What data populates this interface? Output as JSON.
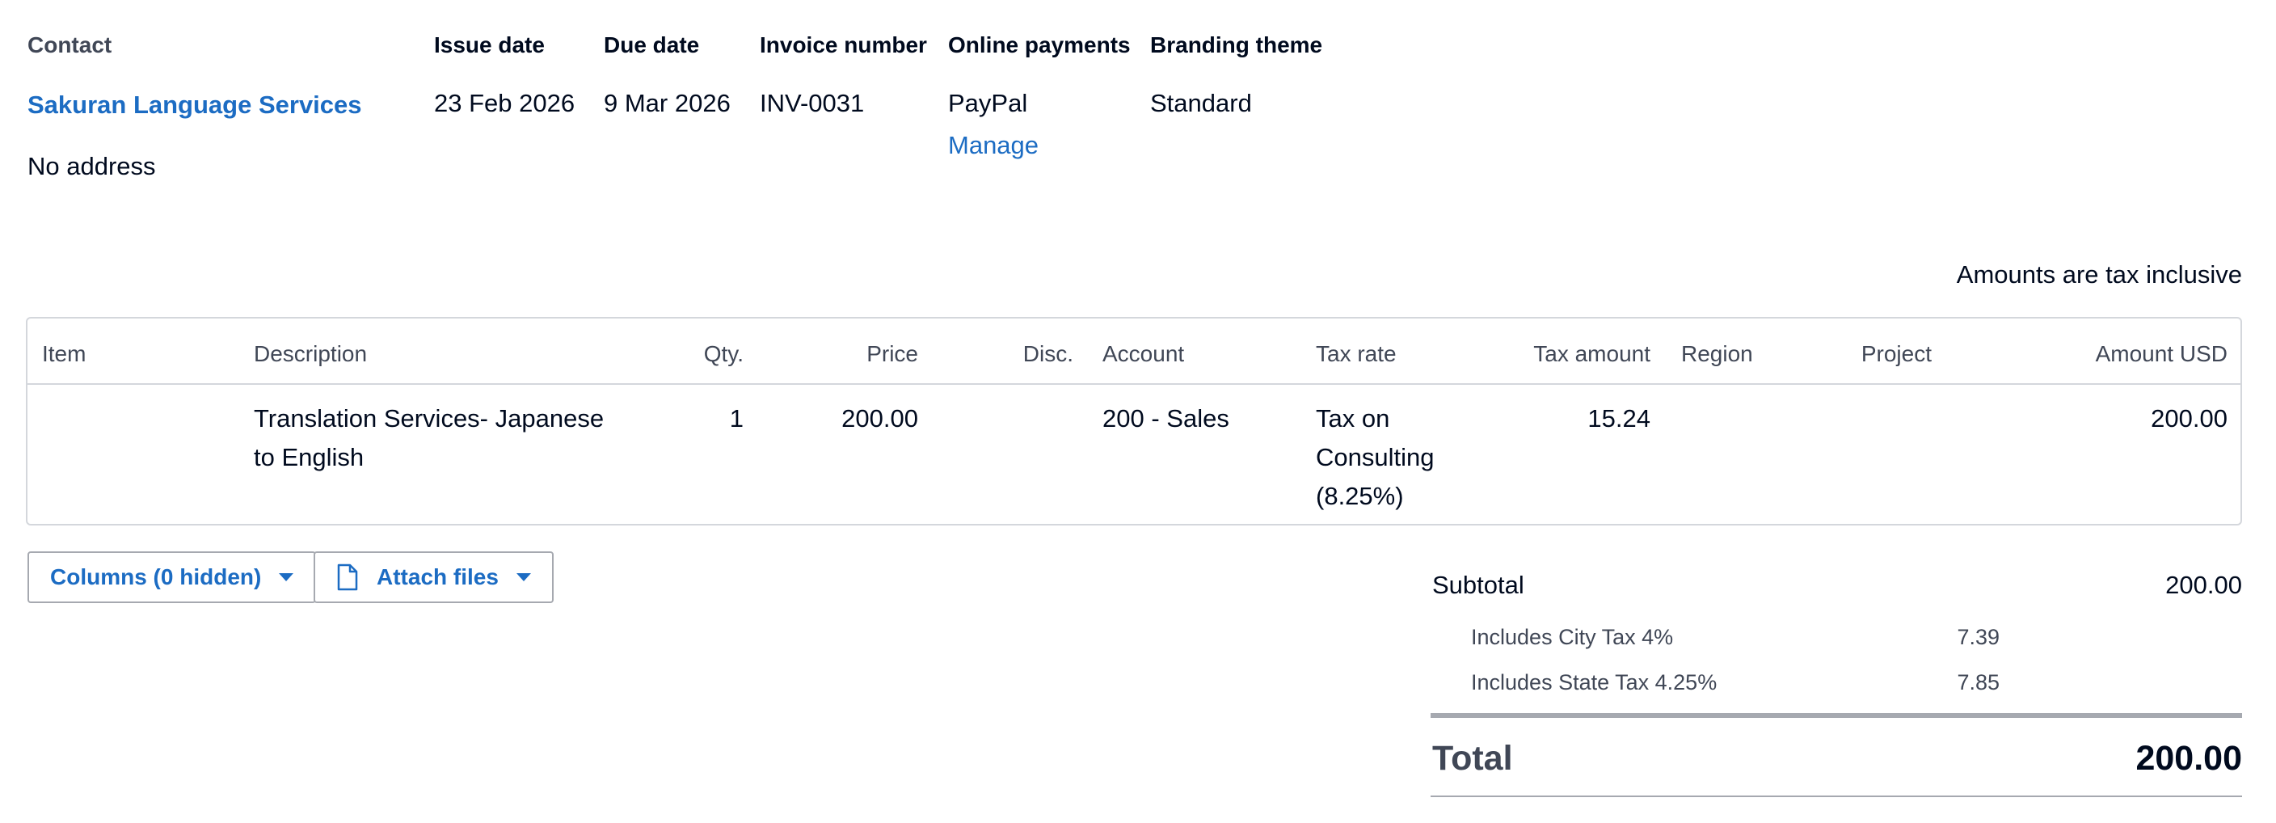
{
  "header": {
    "contact_label": "Contact",
    "contact_name": "Sakuran Language Services",
    "contact_address": "No address",
    "issue_date_label": "Issue date",
    "issue_date": "23 Feb 2026",
    "due_date_label": "Due date",
    "due_date": "9 Mar 2026",
    "invoice_number_label": "Invoice number",
    "invoice_number": "INV-0031",
    "online_payments_label": "Online payments",
    "online_payments_value": "PayPal",
    "manage_link": "Manage",
    "branding_theme_label": "Branding theme",
    "branding_theme": "Standard"
  },
  "tax_mode": "Amounts are tax inclusive",
  "table": {
    "columns": [
      "Item",
      "Description",
      "Qty.",
      "Price",
      "Disc.",
      "Account",
      "Tax rate",
      "Tax amount",
      "Region",
      "Project",
      "Amount USD"
    ],
    "rows": [
      {
        "item": "",
        "description": "Translation Services- Japanese to English",
        "qty": "1",
        "price": "200.00",
        "disc": "",
        "account": "200 - Sales",
        "tax_rate": "Tax on Consulting (8.25%)",
        "tax_amount": "15.24",
        "region": "",
        "project": "",
        "amount": "200.00"
      }
    ]
  },
  "buttons": {
    "columns": "Columns (0 hidden)",
    "attach": "Attach files"
  },
  "totals": {
    "subtotal_label": "Subtotal",
    "subtotal_value": "200.00",
    "tax_lines": [
      {
        "label": "Includes City Tax 4%",
        "value": "7.39"
      },
      {
        "label": "Includes State Tax 4.25%",
        "value": "7.85"
      }
    ],
    "total_label": "Total",
    "total_value": "200.00"
  },
  "colors": {
    "link": "#1c6cc3",
    "text": "#000a1e",
    "muted": "#404756",
    "border": "#d4d7dc"
  },
  "icons": {
    "file": "file-icon",
    "caret": "caret-down-icon"
  }
}
